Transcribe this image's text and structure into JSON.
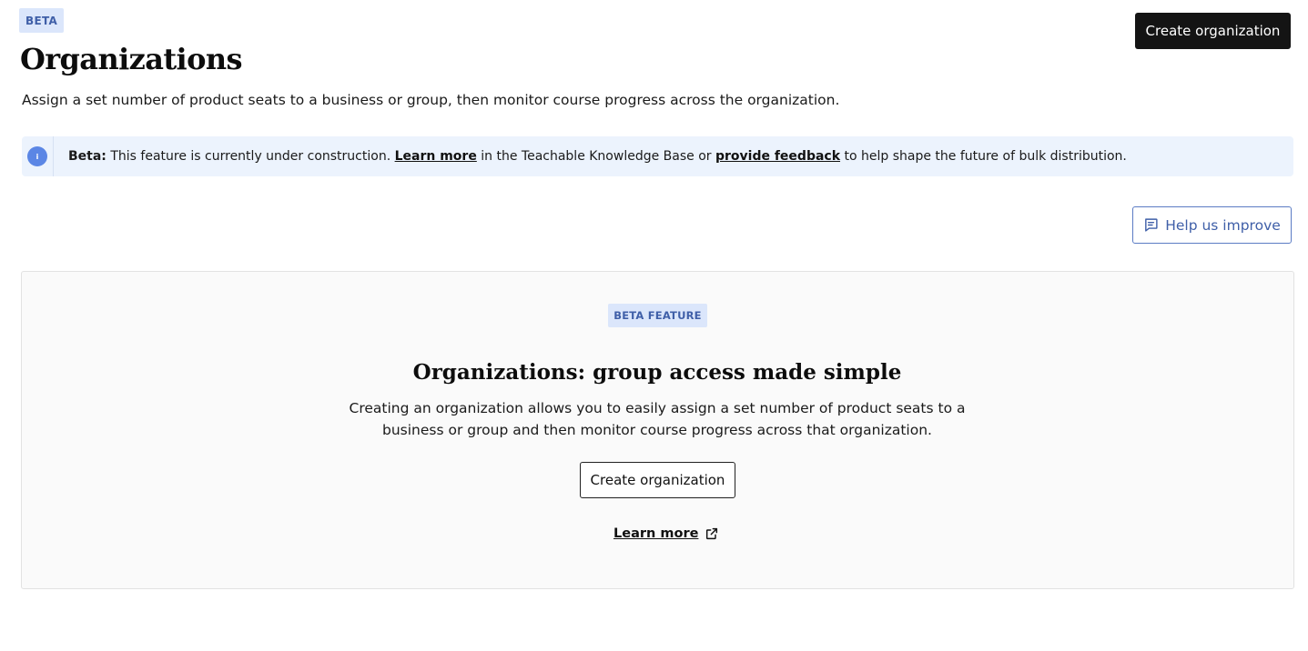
{
  "header": {
    "badge": "BETA",
    "title": "Organizations",
    "create_button": "Create organization",
    "description": "Assign a set number of product seats to a business or group, then monitor course progress across the organization."
  },
  "banner": {
    "icon": "info-icon",
    "icon_glyph": "i",
    "label": "Beta:",
    "text_1": " This feature is currently under construction. ",
    "link_1": "Learn more",
    "text_2": " in the Teachable Knowledge Base or ",
    "link_2": "provide feedback",
    "text_3": " to help shape the future of bulk distribution."
  },
  "feedback_button": {
    "label": "Help us improve",
    "icon": "message-square-icon"
  },
  "empty_state": {
    "badge": "BETA FEATURE",
    "title": "Organizations: group access made simple",
    "description": "Creating an organization allows you to easily assign a set number of product seats to a business or group and then monitor course progress across that organization.",
    "create_button": "Create organization",
    "learn_more": "Learn more",
    "learn_more_icon": "external-link-icon"
  },
  "colors": {
    "accent_blue": "#3f5fa8",
    "badge_bg": "#dbe6fb",
    "banner_bg": "#ecf3fd",
    "info_icon": "#5b86e5",
    "primary_button": "#141414"
  }
}
